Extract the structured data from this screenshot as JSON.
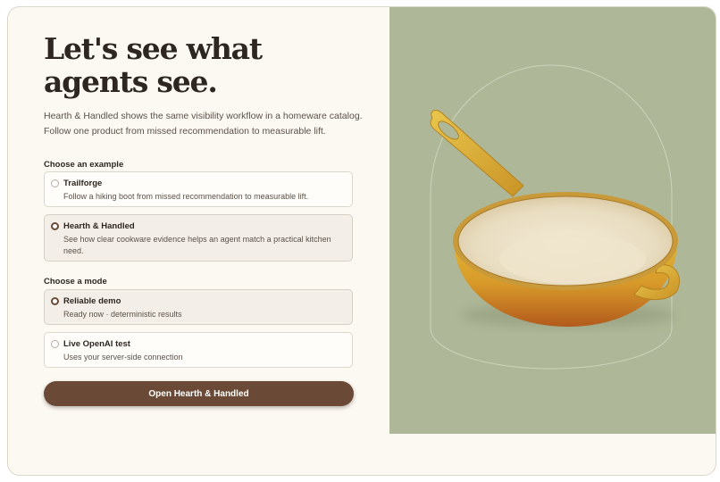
{
  "hero": {
    "title": "Let's see what agents see.",
    "intro": "Hearth & Handled shows the same visibility workflow in a homeware catalog. Follow one product from missed recommendation to measurable lift."
  },
  "examples": {
    "label": "Choose an example",
    "options": [
      {
        "title": "Trailforge",
        "description": "Follow a hiking boot from missed recommendation to measurable lift.",
        "selected": false
      },
      {
        "title": "Hearth & Handled",
        "description": "See how clear cookware evidence helps an agent match a practical kitchen need.",
        "selected": true
      }
    ]
  },
  "modes": {
    "label": "Choose a mode",
    "options": [
      {
        "title": "Reliable demo",
        "description": "Ready now · deterministic results",
        "selected": true
      },
      {
        "title": "Live OpenAI test",
        "description": "Uses your server-side connection",
        "selected": false
      }
    ]
  },
  "cta": {
    "label": "Open Hearth & Handled"
  },
  "illustration": {
    "subject": "enameled-cookware-pan-illustration",
    "background": "#aeb898"
  }
}
